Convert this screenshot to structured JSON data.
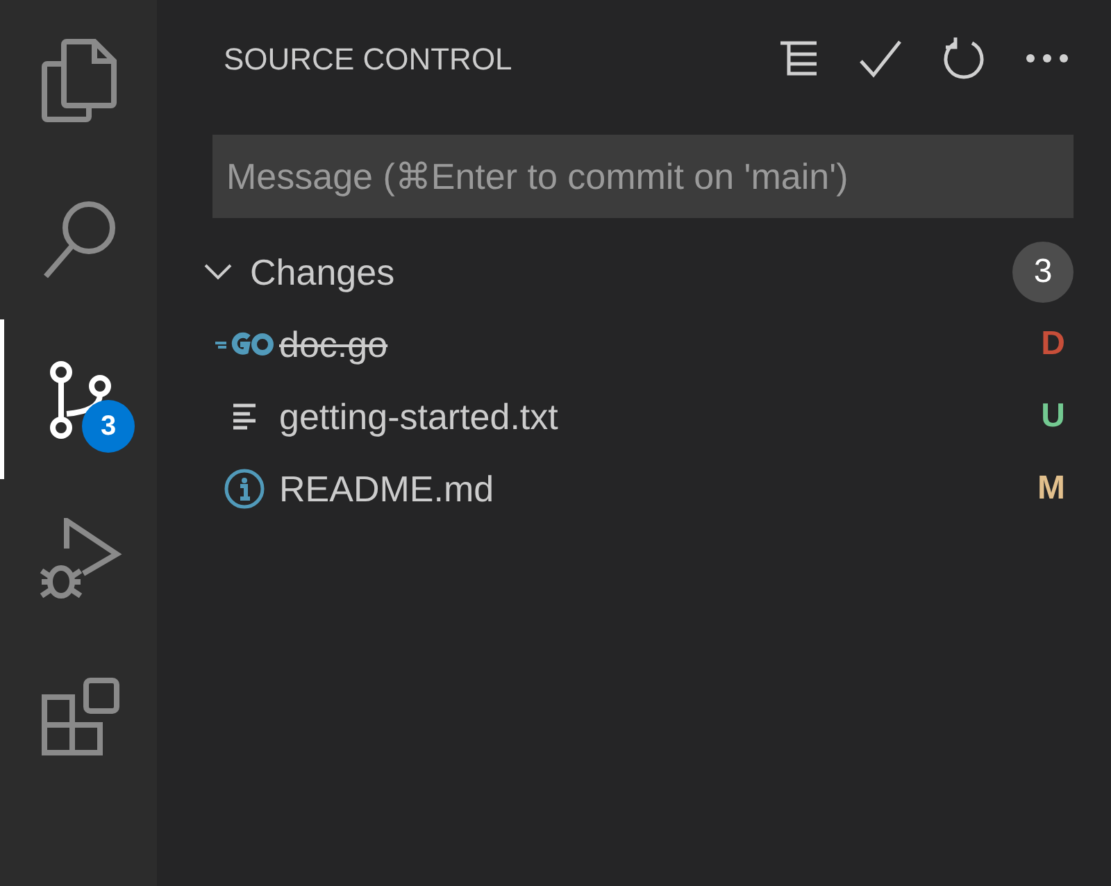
{
  "activity_bar": {
    "items": [
      {
        "kind": "files",
        "selected": false
      },
      {
        "kind": "search",
        "selected": false
      },
      {
        "kind": "source-control",
        "selected": true,
        "badge": "3"
      },
      {
        "kind": "debug",
        "selected": false
      },
      {
        "kind": "extensions",
        "selected": false
      }
    ]
  },
  "panel": {
    "title": "SOURCE CONTROL",
    "actions": [
      {
        "kind": "tree"
      },
      {
        "kind": "check"
      },
      {
        "kind": "refresh"
      },
      {
        "kind": "more"
      }
    ],
    "message": {
      "placeholder": "Message (⌘Enter to commit on 'main')"
    },
    "group": {
      "label": "Changes",
      "expanded": true,
      "count": "3",
      "files": [
        {
          "kind": "go",
          "name": "doc.go",
          "deleted": true,
          "status": "D",
          "color": "#c74e39"
        },
        {
          "kind": "text",
          "name": "getting-started.txt",
          "deleted": false,
          "status": "U",
          "color": "#73c991"
        },
        {
          "kind": "info",
          "name": "README.md",
          "deleted": false,
          "status": "M",
          "color": "#e2c08d"
        }
      ]
    }
  }
}
